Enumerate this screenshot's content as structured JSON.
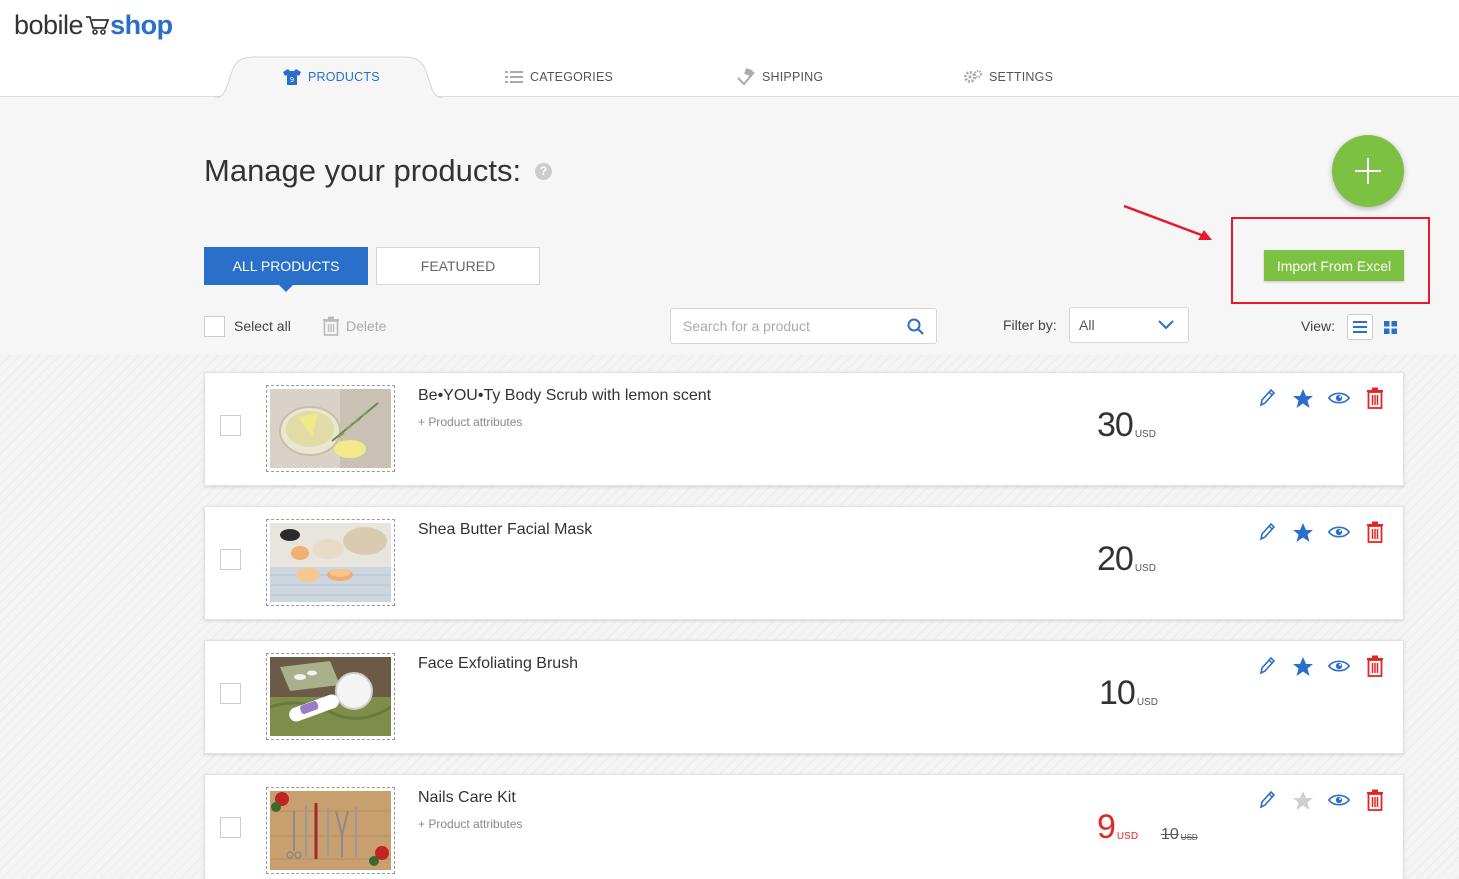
{
  "brand": {
    "part1": "bobile",
    "part2": "shop"
  },
  "nav": {
    "tabs": [
      {
        "label": "PRODUCTS",
        "icon": "shirt-icon",
        "active": true
      },
      {
        "label": "CATEGORIES",
        "icon": "list-icon",
        "active": false
      },
      {
        "label": "SHIPPING",
        "icon": "shipping-icon",
        "active": false
      },
      {
        "label": "SETTINGS",
        "icon": "gear-icon",
        "active": false
      }
    ]
  },
  "header": {
    "title": "Manage your products:",
    "help": "?"
  },
  "actions": {
    "import_label": "Import From Excel",
    "add_icon": "plus-icon"
  },
  "segments": {
    "all": "ALL PRODUCTS",
    "featured": "FEATURED"
  },
  "toolbar": {
    "select_all": "Select all",
    "delete": "Delete",
    "search_placeholder": "Search for a product",
    "filter_label": "Filter by:",
    "filter_value": "All",
    "view_label": "View:"
  },
  "products": [
    {
      "name": "Be•YOU•Ty Body Scrub with lemon scent",
      "attrs": "+ Product attributes",
      "price": "30",
      "currency": "USD",
      "featured": true
    },
    {
      "name": "Shea Butter Facial Mask",
      "attrs": "",
      "price": "20",
      "currency": "USD",
      "featured": true
    },
    {
      "name": "Face Exfoliating Brush",
      "attrs": "",
      "price": "10",
      "currency": "USD",
      "featured": true
    },
    {
      "name": "Nails Care Kit",
      "attrs": "+ Product attributes",
      "price": "9",
      "currency": "USD",
      "old_price": "10",
      "old_currency": "USD",
      "featured": false
    }
  ],
  "colors": {
    "accent": "#2a6fc9",
    "green": "#7cc142",
    "danger": "#e52525",
    "highlight": "#e8192c"
  }
}
